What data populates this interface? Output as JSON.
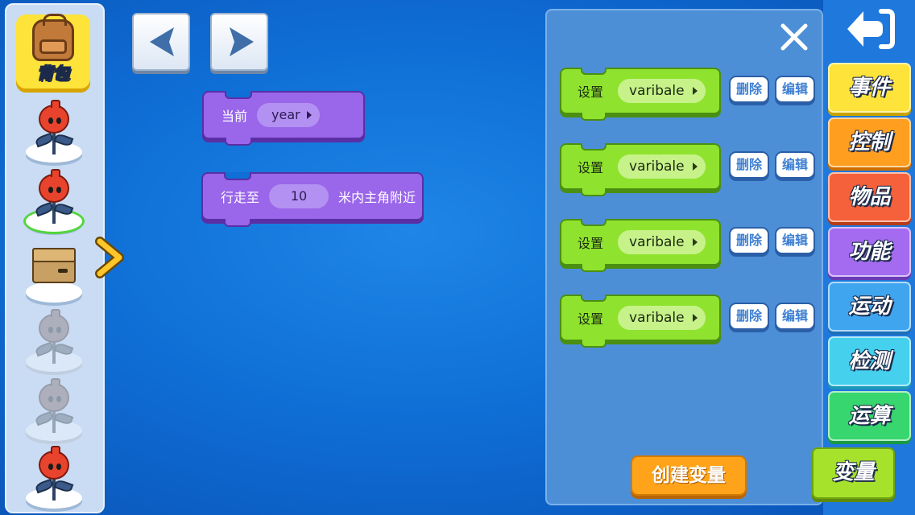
{
  "sidebar": {
    "backpack_label": "背包",
    "sprites": [
      {
        "kind": "flower",
        "state": "normal"
      },
      {
        "kind": "flower",
        "state": "selected"
      },
      {
        "kind": "crate",
        "state": "normal"
      },
      {
        "kind": "flower",
        "state": "faded"
      },
      {
        "kind": "flower",
        "state": "faded"
      },
      {
        "kind": "flower",
        "state": "normal"
      }
    ],
    "collapse_icon": "chevron-right-icon"
  },
  "nav": {
    "back_icon": "triangle-left-icon",
    "forward_icon": "triangle-right-icon"
  },
  "workspace": {
    "block1": {
      "label": "当前",
      "dropdown": "year"
    },
    "block2": {
      "prefix": "行走至",
      "value": "10",
      "suffix": "米内主角附近"
    }
  },
  "panel": {
    "close_icon": "close-icon",
    "rows": [
      {
        "set_label": "设置",
        "variable": "varibale",
        "delete_label": "删除",
        "edit_label": "编辑"
      },
      {
        "set_label": "设置",
        "variable": "varibale",
        "delete_label": "删除",
        "edit_label": "编辑"
      },
      {
        "set_label": "设置",
        "variable": "varibale",
        "delete_label": "删除",
        "edit_label": "编辑"
      },
      {
        "set_label": "设置",
        "variable": "varibale",
        "delete_label": "删除",
        "edit_label": "编辑"
      }
    ],
    "create_label": "创建变量"
  },
  "categories": {
    "back_icon": "return-arrow-icon",
    "items": [
      {
        "label": "事件",
        "color": "#fde33a",
        "shadow": "#c9a400"
      },
      {
        "label": "控制",
        "color": "#ff9e1f",
        "shadow": "#cf6e00"
      },
      {
        "label": "物品",
        "color": "#f5613a",
        "shadow": "#b83a16"
      },
      {
        "label": "功能",
        "color": "#a46bf0",
        "shadow": "#6a3bb4"
      },
      {
        "label": "运动",
        "color": "#3fa5ef",
        "shadow": "#1c6fb8"
      },
      {
        "label": "检测",
        "color": "#45d0ee",
        "shadow": "#1c98b8"
      },
      {
        "label": "运算",
        "color": "#37d66e",
        "shadow": "#179a45"
      },
      {
        "label": "变量",
        "color": "#a6e22b",
        "shadow": "#5d8a0e",
        "active": true
      }
    ]
  }
}
